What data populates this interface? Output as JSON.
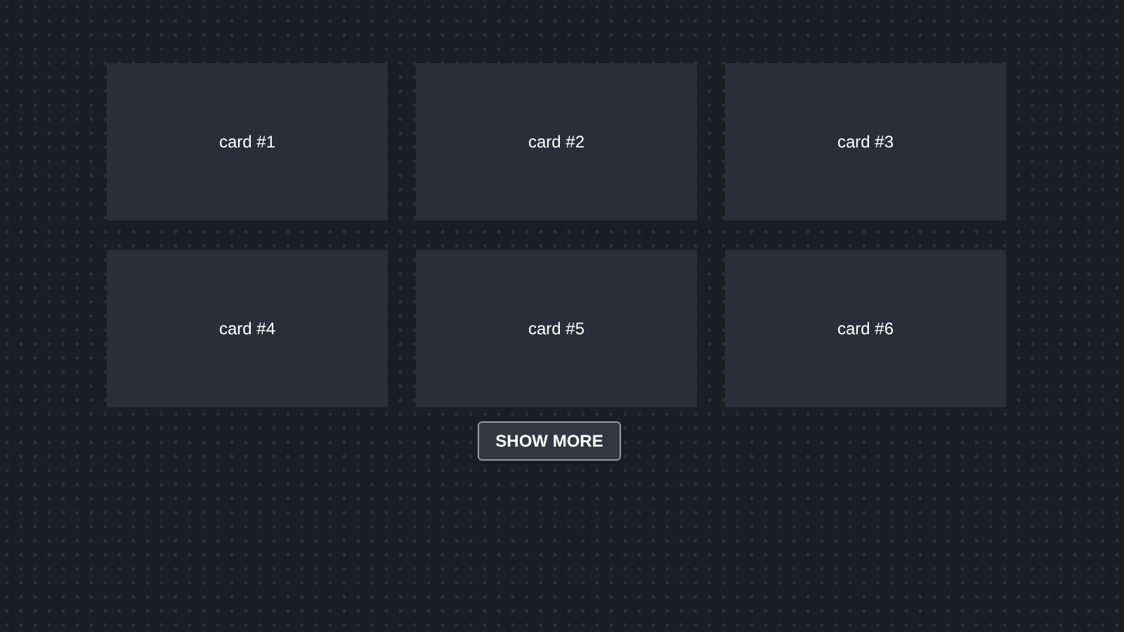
{
  "cards": [
    {
      "label": "card #1"
    },
    {
      "label": "card #2"
    },
    {
      "label": "card #3"
    },
    {
      "label": "card #4"
    },
    {
      "label": "card #5"
    },
    {
      "label": "card #6"
    }
  ],
  "button": {
    "label": "SHOW MORE"
  }
}
